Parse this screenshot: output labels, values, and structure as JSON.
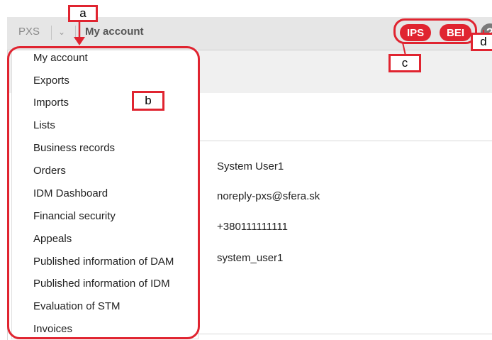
{
  "header": {
    "brand": "PXS",
    "dropdown_icon": "chevron-down-icon",
    "title": "My account",
    "badges": [
      "IPS",
      "BEI"
    ],
    "help_label": "?"
  },
  "menu": {
    "items": [
      "My account",
      "Exports",
      "Imports",
      "Lists",
      "Business records",
      "Orders",
      "IDM Dashboard",
      "Financial security",
      "Appeals",
      "Published information of DAM",
      "Published information of IDM",
      "Evaluation of STM",
      "Invoices"
    ]
  },
  "profile": {
    "name": "System User1",
    "email": "noreply-pxs@sfera.sk",
    "phone": "+380111111111",
    "username": "system_user1"
  },
  "annotations": {
    "a": "a",
    "b": "b",
    "c": "c",
    "d": "d"
  },
  "colors": {
    "accent": "#e02430",
    "topbar": "#e6e6e6"
  }
}
